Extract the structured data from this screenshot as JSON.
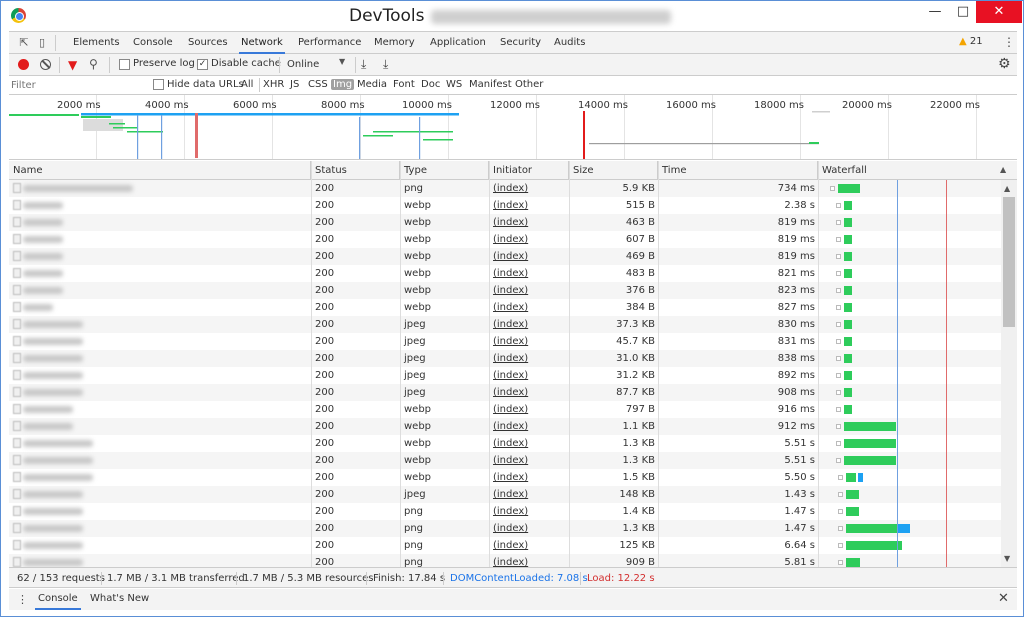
{
  "window": {
    "title": "DevTools"
  },
  "tabs": [
    "Elements",
    "Console",
    "Sources",
    "Network",
    "Performance",
    "Memory",
    "Application",
    "Security",
    "Audits"
  ],
  "active_tab": "Network",
  "warning_count": "21",
  "toolbar": {
    "preserve_log": "Preserve log",
    "disable_cache": "Disable cache",
    "throttle": "Online"
  },
  "filter": {
    "placeholder": "Filter",
    "hide_data_urls": "Hide data URLs",
    "types": [
      "All",
      "XHR",
      "JS",
      "CSS",
      "Img",
      "Media",
      "Font",
      "Doc",
      "WS",
      "Manifest",
      "Other"
    ],
    "active_type": "Img"
  },
  "overview": {
    "ticks": [
      "2000 ms",
      "4000 ms",
      "6000 ms",
      "8000 ms",
      "10000 ms",
      "12000 ms",
      "14000 ms",
      "16000 ms",
      "18000 ms",
      "20000 ms",
      "22000 ms"
    ]
  },
  "columns": {
    "name": "Name",
    "status": "Status",
    "type": "Type",
    "initiator": "Initiator",
    "size": "Size",
    "time": "Time",
    "waterfall": "Waterfall"
  },
  "rows": [
    {
      "status": "200",
      "type": "png",
      "initiator": "(index)",
      "size": "5.9 KB",
      "time": "734 ms",
      "name_w": 110
    },
    {
      "status": "200",
      "type": "webp",
      "initiator": "(index)",
      "size": "515 B",
      "time": "2.38 s",
      "name_w": 40
    },
    {
      "status": "200",
      "type": "webp",
      "initiator": "(index)",
      "size": "463 B",
      "time": "819 ms",
      "name_w": 40
    },
    {
      "status": "200",
      "type": "webp",
      "initiator": "(index)",
      "size": "607 B",
      "time": "819 ms",
      "name_w": 40
    },
    {
      "status": "200",
      "type": "webp",
      "initiator": "(index)",
      "size": "469 B",
      "time": "819 ms",
      "name_w": 40
    },
    {
      "status": "200",
      "type": "webp",
      "initiator": "(index)",
      "size": "483 B",
      "time": "821 ms",
      "name_w": 40
    },
    {
      "status": "200",
      "type": "webp",
      "initiator": "(index)",
      "size": "376 B",
      "time": "823 ms",
      "name_w": 40
    },
    {
      "status": "200",
      "type": "webp",
      "initiator": "(index)",
      "size": "384 B",
      "time": "827 ms",
      "name_w": 30
    },
    {
      "status": "200",
      "type": "jpeg",
      "initiator": "(index)",
      "size": "37.3 KB",
      "time": "830 ms",
      "name_w": 60
    },
    {
      "status": "200",
      "type": "jpeg",
      "initiator": "(index)",
      "size": "45.7 KB",
      "time": "831 ms",
      "name_w": 60
    },
    {
      "status": "200",
      "type": "jpeg",
      "initiator": "(index)",
      "size": "31.0 KB",
      "time": "838 ms",
      "name_w": 60
    },
    {
      "status": "200",
      "type": "jpeg",
      "initiator": "(index)",
      "size": "31.2 KB",
      "time": "892 ms",
      "name_w": 60
    },
    {
      "status": "200",
      "type": "jpeg",
      "initiator": "(index)",
      "size": "87.7 KB",
      "time": "908 ms",
      "name_w": 60
    },
    {
      "status": "200",
      "type": "webp",
      "initiator": "(index)",
      "size": "797 B",
      "time": "916 ms",
      "name_w": 50
    },
    {
      "status": "200",
      "type": "webp",
      "initiator": "(index)",
      "size": "1.1 KB",
      "time": "912 ms",
      "name_w": 50
    },
    {
      "status": "200",
      "type": "webp",
      "initiator": "(index)",
      "size": "1.3 KB",
      "time": "5.51 s",
      "name_w": 70
    },
    {
      "status": "200",
      "type": "webp",
      "initiator": "(index)",
      "size": "1.3 KB",
      "time": "5.51 s",
      "name_w": 70
    },
    {
      "status": "200",
      "type": "webp",
      "initiator": "(index)",
      "size": "1.5 KB",
      "time": "5.50 s",
      "name_w": 70
    },
    {
      "status": "200",
      "type": "jpeg",
      "initiator": "(index)",
      "size": "148 KB",
      "time": "1.43 s",
      "name_w": 60
    },
    {
      "status": "200",
      "type": "png",
      "initiator": "(index)",
      "size": "1.4 KB",
      "time": "1.47 s",
      "name_w": 60
    },
    {
      "status": "200",
      "type": "png",
      "initiator": "(index)",
      "size": "1.3 KB",
      "time": "1.47 s",
      "name_w": 60
    },
    {
      "status": "200",
      "type": "png",
      "initiator": "(index)",
      "size": "125 KB",
      "time": "6.64 s",
      "name_w": 60
    },
    {
      "status": "200",
      "type": "png",
      "initiator": "(index)",
      "size": "909 B",
      "time": "5.81 s",
      "name_w": 60
    }
  ],
  "status": {
    "requests": "62 / 153 requests",
    "transferred": "1.7 MB / 3.1 MB transferred",
    "resources": "1.7 MB / 5.3 MB resources",
    "finish": "Finish: 17.84 s",
    "dcl": "DOMContentLoaded: 7.08 s",
    "load": "Load: 12.22 s"
  },
  "drawer": {
    "tabs": [
      "Console",
      "What's New"
    ],
    "active": "Console"
  },
  "colors": {
    "accent": "#3879d9",
    "record": "#e21b1b",
    "bar": "#2ecc5b",
    "dcl": "#1a73e8",
    "load": "#d32f2f"
  }
}
